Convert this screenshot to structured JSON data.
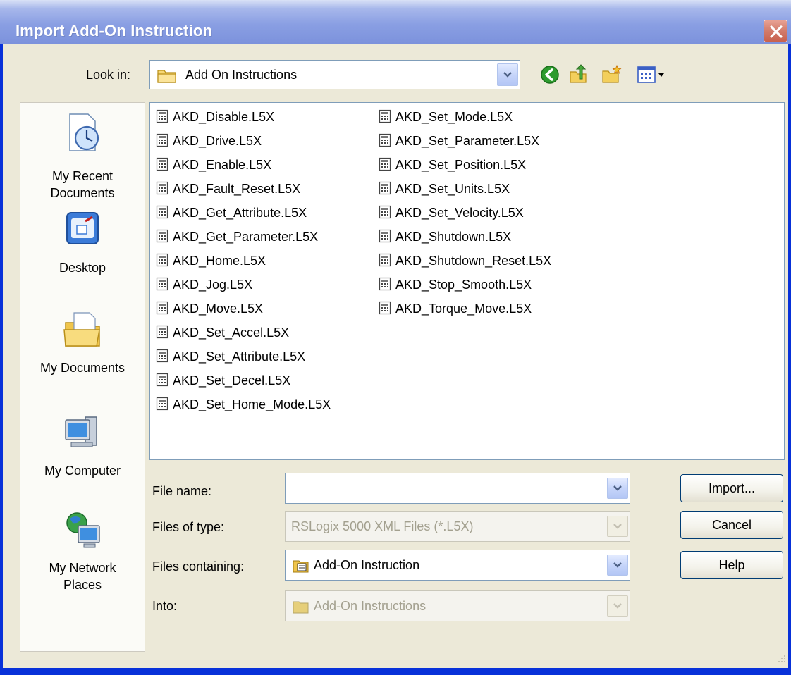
{
  "window": {
    "title": "Import Add-On Instruction",
    "close_label": "close"
  },
  "lookin": {
    "label": "Look in:",
    "value": "Add On Instructions"
  },
  "toolbar": {
    "icons": [
      "back-icon",
      "up-folder-icon",
      "new-folder-icon",
      "view-menu-icon"
    ]
  },
  "places": [
    {
      "label": "My Recent Documents",
      "line1": "My Recent",
      "line2": "Documents",
      "icon": "recent-documents-icon"
    },
    {
      "label": "Desktop",
      "line1": "Desktop",
      "line2": "",
      "icon": "desktop-icon"
    },
    {
      "label": "My Documents",
      "line1": "My Documents",
      "line2": "",
      "icon": "my-documents-icon"
    },
    {
      "label": "My Computer",
      "line1": "My Computer",
      "line2": "",
      "icon": "my-computer-icon"
    },
    {
      "label": "My Network Places",
      "line1": "My Network",
      "line2": "Places",
      "icon": "network-places-icon"
    }
  ],
  "files": {
    "column1": [
      "AKD_Disable.L5X",
      "AKD_Drive.L5X",
      "AKD_Enable.L5X",
      "AKD_Fault_Reset.L5X",
      "AKD_Get_Attribute.L5X",
      "AKD_Get_Parameter.L5X",
      "AKD_Home.L5X",
      "AKD_Jog.L5X",
      "AKD_Move.L5X",
      "AKD_Set_Accel.L5X",
      "AKD_Set_Attribute.L5X",
      "AKD_Set_Decel.L5X",
      "AKD_Set_Home_Mode.L5X"
    ],
    "column2": [
      "AKD_Set_Mode.L5X",
      "AKD_Set_Parameter.L5X",
      "AKD_Set_Position.L5X",
      "AKD_Set_Units.L5X",
      "AKD_Set_Velocity.L5X",
      "AKD_Shutdown.L5X",
      "AKD_Shutdown_Reset.L5X",
      "AKD_Stop_Smooth.L5X",
      "AKD_Torque_Move.L5X"
    ]
  },
  "form": {
    "file_name": {
      "label": "File name:",
      "value": ""
    },
    "files_of_type": {
      "label": "Files of type:",
      "value": "RSLogix 5000 XML Files (*.L5X)"
    },
    "files_containing": {
      "label": "Files containing:",
      "value": "Add-On Instruction"
    },
    "into": {
      "label": "Into:",
      "value": "Add-On Instructions"
    }
  },
  "buttons": {
    "import": "Import...",
    "cancel": "Cancel",
    "help": "Help"
  },
  "colors": {
    "title_bar": "#8ea4e6",
    "window_frame": "#0831d9",
    "dialog_bg": "#ece9d8",
    "close_button": "#d27b6a"
  }
}
